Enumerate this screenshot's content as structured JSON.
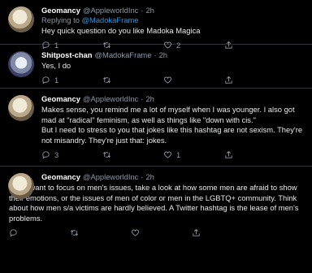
{
  "tweets": [
    {
      "name": "Geomancy",
      "handle": "@AppleworldInc",
      "sep": "·",
      "time": "2h",
      "reply_prefix": "Replying to",
      "reply_to": "@MadokaFrame",
      "text": "Hey quick question do you like Madoka Magica",
      "replies": "1",
      "retweets": "",
      "likes": "2",
      "avatar": "anime-avatar-blonde"
    },
    {
      "name": "Shitpost-chan",
      "handle": "@MadokaFrame",
      "sep": "·",
      "time": "2h",
      "text": "Yes, I do",
      "replies": "1",
      "retweets": "",
      "likes": "",
      "avatar": "anime-avatar-dark"
    },
    {
      "name": "Geomancy",
      "handle": "@AppleworldInc",
      "sep": "·",
      "time": "2h",
      "text": "Makes sense, you remind me a lot of myself when I was younger. I also got mad at \"radical\" feminism, as well as things like \"down with cis.\"\nBut I need to stress to you that jokes like this hashtag are not sexism. They're not misandry. They're just that: jokes.",
      "replies": "3",
      "retweets": "",
      "likes": "1",
      "avatar": "anime-avatar-blonde"
    },
    {
      "name": "Geomancy",
      "handle": "@AppleworldInc",
      "sep": "·",
      "time": "2h",
      "text": "If you want to focus on men's issues, take a look at how some men are afraid to show their emotions, or the issues of men of color or men in the LGBTQ+ community. Think about how men s/a victims are hardly believed. A Twitter hashtag is the lease of men's problems.",
      "replies": "",
      "retweets": "",
      "likes": "",
      "avatar": "anime-avatar-blonde"
    }
  ],
  "icons": [
    "reply-icon",
    "retweet-icon",
    "like-icon",
    "share-icon"
  ]
}
